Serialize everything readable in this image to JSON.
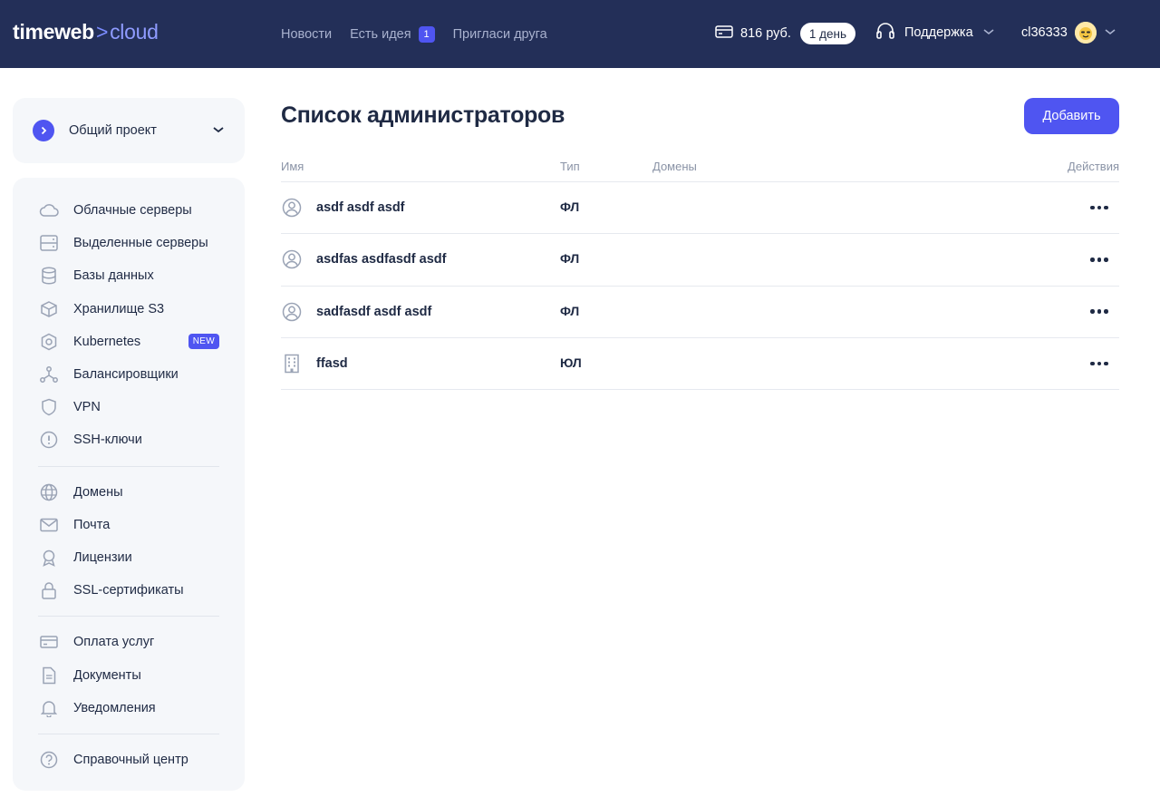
{
  "header": {
    "logo_main": "timeweb",
    "logo_sep": ">",
    "logo_sub": "cloud",
    "nav": [
      {
        "label": "Новости"
      },
      {
        "label": "Есть идея",
        "badge": "1"
      },
      {
        "label": "Пригласи друга"
      }
    ],
    "balance": "816 руб.",
    "days": "1 день",
    "support_label": "Поддержка",
    "username": "cl36333"
  },
  "sidebar": {
    "project_name": "Общий проект",
    "groups": [
      [
        {
          "label": "Облачные серверы",
          "icon": "cloud-icon"
        },
        {
          "label": "Выделенные серверы",
          "icon": "server-icon"
        },
        {
          "label": "Базы данных",
          "icon": "database-icon"
        },
        {
          "label": "Хранилище S3",
          "icon": "cube-icon"
        },
        {
          "label": "Kubernetes",
          "icon": "kubernetes-icon",
          "badge": "NEW"
        },
        {
          "label": "Балансировщики",
          "icon": "balancer-icon"
        },
        {
          "label": "VPN",
          "icon": "shield-icon"
        },
        {
          "label": "SSH-ключи",
          "icon": "key-icon"
        }
      ],
      [
        {
          "label": "Домены",
          "icon": "globe-icon"
        },
        {
          "label": "Почта",
          "icon": "mail-icon"
        },
        {
          "label": "Лицензии",
          "icon": "award-icon"
        },
        {
          "label": "SSL-сертификаты",
          "icon": "lock-icon"
        }
      ],
      [
        {
          "label": "Оплата услуг",
          "icon": "card-icon"
        },
        {
          "label": "Документы",
          "icon": "document-icon"
        },
        {
          "label": "Уведомления",
          "icon": "bell-icon"
        }
      ],
      [
        {
          "label": "Справочный центр",
          "icon": "help-icon"
        }
      ]
    ]
  },
  "main": {
    "title": "Список администраторов",
    "add_label": "Добавить",
    "columns": {
      "name": "Имя",
      "type": "Тип",
      "domains": "Домены",
      "actions": "Действия"
    },
    "rows": [
      {
        "name": "asdf asdf asdf",
        "type": "ФЛ",
        "icon": "person-icon",
        "domains": ""
      },
      {
        "name": "asdfas asdfasdf asdf",
        "type": "ФЛ",
        "icon": "person-icon",
        "domains": ""
      },
      {
        "name": "sadfasdf asdf asdf",
        "type": "ФЛ",
        "icon": "person-icon",
        "domains": ""
      },
      {
        "name": "ffasd",
        "type": "ЮЛ",
        "icon": "building-icon",
        "domains": ""
      }
    ]
  },
  "colors": {
    "header_bg": "#232f58",
    "accent": "#4f55f1",
    "sidebar_bg": "#f5f7fa",
    "text": "#1f2a44",
    "muted": "#8a93a6"
  }
}
